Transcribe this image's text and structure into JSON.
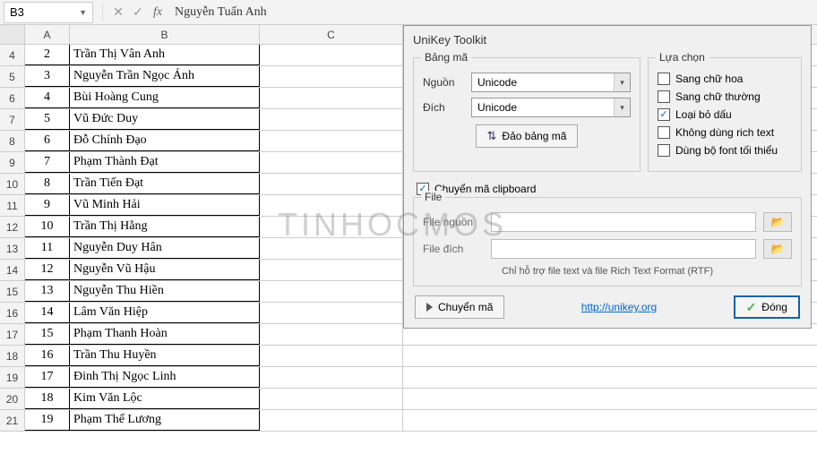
{
  "formula_bar": {
    "name_box": "B3",
    "formula": "Nguyễn Tuấn Anh"
  },
  "columns": [
    "A",
    "B",
    "C"
  ],
  "rows": [
    {
      "n": 4,
      "a": "2",
      "b": "Trần Thị Vân Anh"
    },
    {
      "n": 5,
      "a": "3",
      "b": "Nguyễn Trần Ngọc Ánh"
    },
    {
      "n": 6,
      "a": "4",
      "b": "Bùi Hoàng Cung"
    },
    {
      "n": 7,
      "a": "5",
      "b": "Vũ Đức Duy"
    },
    {
      "n": 8,
      "a": "6",
      "b": "Đỗ Chính Đạo"
    },
    {
      "n": 9,
      "a": "7",
      "b": "Phạm Thành Đạt"
    },
    {
      "n": 10,
      "a": "8",
      "b": "Trần Tiến Đạt"
    },
    {
      "n": 11,
      "a": "9",
      "b": "Vũ Minh Hải"
    },
    {
      "n": 12,
      "a": "10",
      "b": "Trần Thị Hằng"
    },
    {
      "n": 13,
      "a": "11",
      "b": "Nguyễn Duy Hân"
    },
    {
      "n": 14,
      "a": "12",
      "b": "Nguyễn Vũ Hậu"
    },
    {
      "n": 15,
      "a": "13",
      "b": "Nguyễn Thu Hiền"
    },
    {
      "n": 16,
      "a": "14",
      "b": "Lâm Văn Hiệp"
    },
    {
      "n": 17,
      "a": "15",
      "b": "Phạm Thanh Hoàn"
    },
    {
      "n": 18,
      "a": "16",
      "b": "Trần Thu Huyền"
    },
    {
      "n": 19,
      "a": "17",
      "b": "Đinh Thị Ngọc Linh"
    },
    {
      "n": 20,
      "a": "18",
      "b": "Kim Văn Lộc"
    },
    {
      "n": 21,
      "a": "19",
      "b": "Phạm Thế Lương"
    }
  ],
  "dialog": {
    "title": "UniKey Toolkit",
    "bang_ma": {
      "group": "Bảng mã",
      "nguon_label": "Nguồn",
      "nguon_value": "Unicode",
      "dich_label": "Đích",
      "dich_value": "Unicode",
      "swap_btn": "Đảo bảng mã"
    },
    "lua_chon": {
      "group": "Lựa chọn",
      "hoa": "Sang chữ hoa",
      "thuong": "Sang chữ thường",
      "loai_dau": "Loại bỏ dấu",
      "rich": "Không dùng rich text",
      "font_min": "Dùng bộ font tối thiểu"
    },
    "clipboard": "Chuyển mã clipboard",
    "file": {
      "group": "File",
      "nguon": "File nguồn",
      "dich": "File đích",
      "hint": "Chỉ hỗ trợ file text và file Rich Text Format (RTF)"
    },
    "footer": {
      "convert": "Chuyển mã",
      "link": "http://unikey.org",
      "close": "Đóng"
    }
  },
  "watermark": "TINHOCMOS"
}
